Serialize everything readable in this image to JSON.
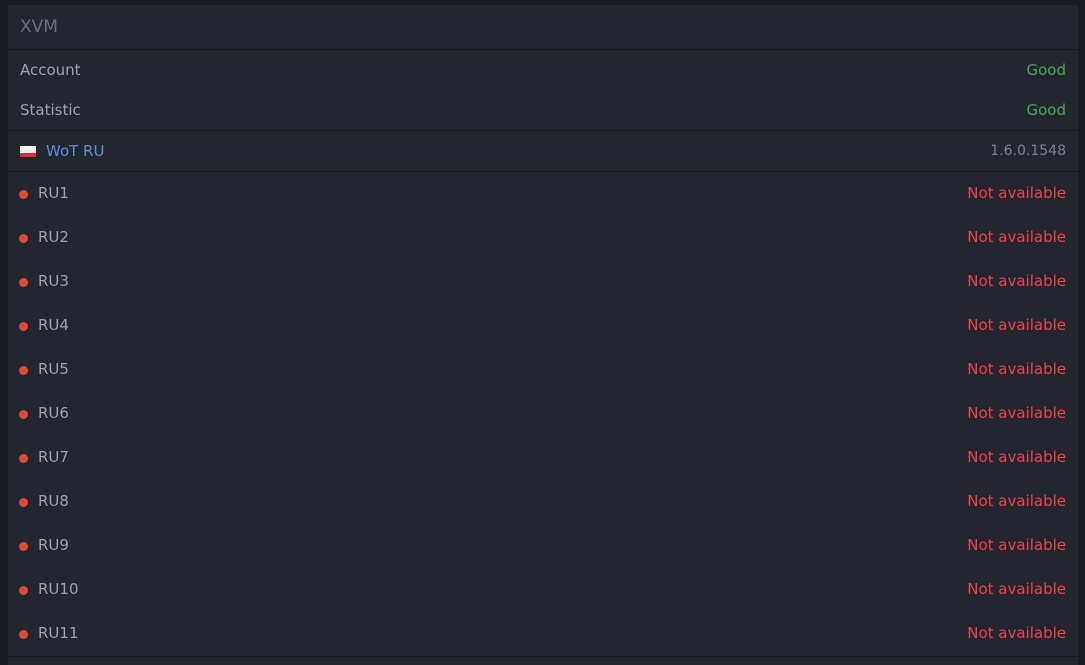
{
  "header": {
    "title": "XVM"
  },
  "xvm_status": [
    {
      "label": "Account",
      "value": "Good"
    },
    {
      "label": "Statistic",
      "value": "Good"
    }
  ],
  "server_group": {
    "name": "WoT RU",
    "version": "1.6.0.1548",
    "flag_icon": "russia-flag-icon",
    "servers": [
      {
        "name": "RU1",
        "status": "Not available"
      },
      {
        "name": "RU2",
        "status": "Not available"
      },
      {
        "name": "RU3",
        "status": "Not available"
      },
      {
        "name": "RU4",
        "status": "Not available"
      },
      {
        "name": "RU5",
        "status": "Not available"
      },
      {
        "name": "RU6",
        "status": "Not available"
      },
      {
        "name": "RU7",
        "status": "Not available"
      },
      {
        "name": "RU8",
        "status": "Not available"
      },
      {
        "name": "RU9",
        "status": "Not available"
      },
      {
        "name": "RU10",
        "status": "Not available"
      },
      {
        "name": "RU11",
        "status": "Not available"
      }
    ]
  },
  "colors": {
    "good": "#4aa85a",
    "unavailable": "#f0434b",
    "link": "#5b8fd8",
    "status_dot": "#e04a3a"
  }
}
